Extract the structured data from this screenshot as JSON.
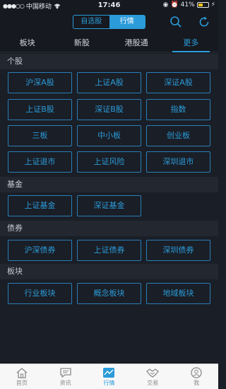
{
  "status_bar": {
    "carrier": "中国移动",
    "time": "17:46",
    "battery": "41%"
  },
  "nav": {
    "segments": [
      "自选股",
      "行情"
    ],
    "active_segment": 1
  },
  "tabs": [
    "板块",
    "新股",
    "港股通",
    "更多"
  ],
  "sections": [
    {
      "title": "个股",
      "buttons": [
        "沪深A股",
        "上证A股",
        "深证A股",
        "上证B股",
        "深证B股",
        "指数",
        "三板",
        "中小板",
        "创业板",
        "上证退市",
        "上证风险",
        "深圳退市"
      ]
    },
    {
      "title": "基金",
      "buttons": [
        "上证基金",
        "深证基金"
      ]
    },
    {
      "title": "债券",
      "buttons": [
        "沪深债券",
        "上证债券",
        "深圳债券"
      ]
    },
    {
      "title": "板块",
      "buttons": [
        "行业板块",
        "概念板块",
        "地域板块"
      ]
    }
  ],
  "tabbar": [
    "首页",
    "资讯",
    "行情",
    "交易",
    "我"
  ],
  "colors": {
    "accent": "#2b9bd9",
    "background": "#1a1e26",
    "section_bg": "#23272f"
  }
}
